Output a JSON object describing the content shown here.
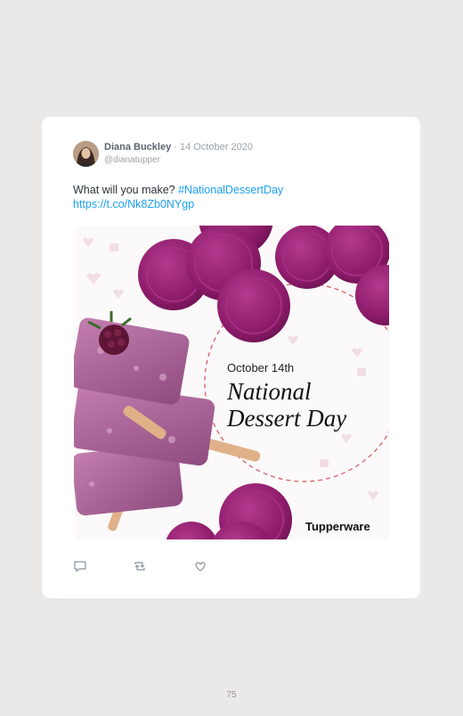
{
  "tweet": {
    "author_name": "Diana Buckley",
    "separator": "·",
    "date": "14 October 2020",
    "handle": "@dianatupper",
    "text": "What will you make?",
    "hashtag": "#NationalDessertDay",
    "link": "https://t.co/Nk8Zb0NYgp"
  },
  "media": {
    "date_line": "October 14th",
    "title_line1": "National",
    "title_line2": "Dessert Day",
    "brand": "Tupperware",
    "accent_color": "#8e1c6b"
  },
  "actions": {
    "icons": [
      "reply-icon",
      "retweet-icon",
      "like-icon"
    ]
  },
  "page_number": "75"
}
